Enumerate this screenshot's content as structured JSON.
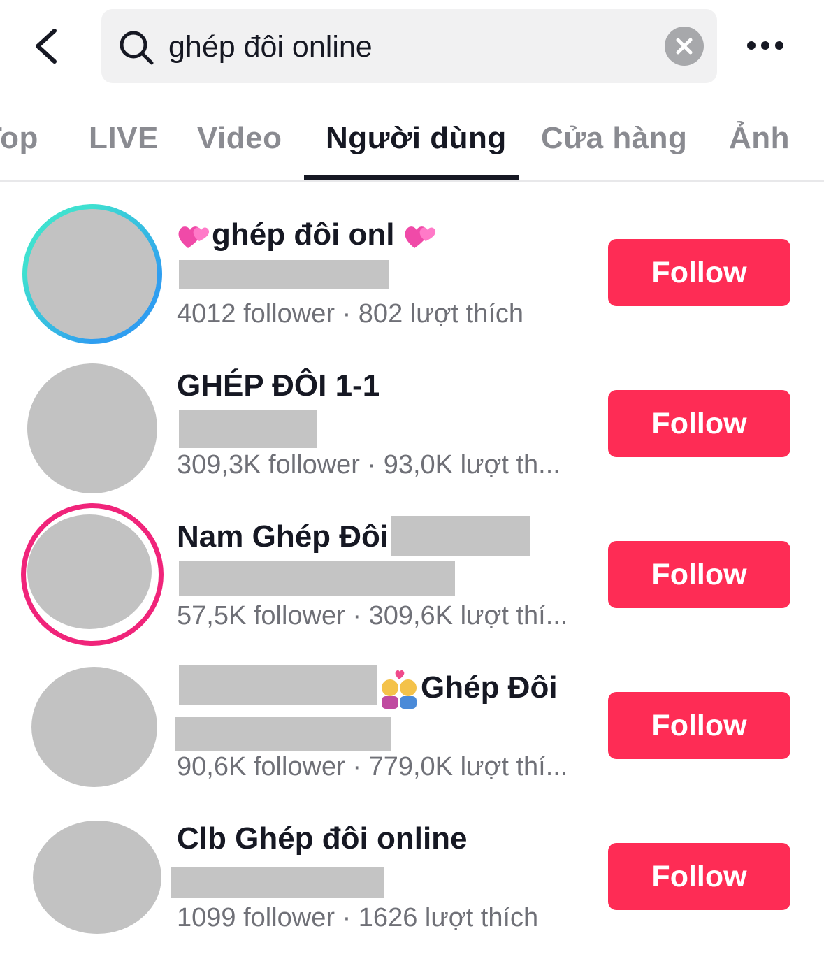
{
  "search": {
    "query": "ghép đôi online"
  },
  "tabs": [
    {
      "label": "Top"
    },
    {
      "label": "LIVE"
    },
    {
      "label": "Video"
    },
    {
      "label": "Người dùng",
      "active": true
    },
    {
      "label": "Cửa hàng"
    },
    {
      "label": "Ảnh"
    }
  ],
  "results": [
    {
      "name": "ghép đôi onl",
      "name_emoji": "heart-sparkle-emoji",
      "stats": "4012 follower · 802 lượt thích",
      "follow_label": "Follow"
    },
    {
      "name": "GHÉP ĐÔI 1-1",
      "stats": "309,3K follower · 93,0K lượt th...",
      "follow_label": "Follow"
    },
    {
      "name": "Nam Ghép Đôi",
      "stats": "57,5K follower · 309,6K lượt thí...",
      "follow_label": "Follow"
    },
    {
      "name": "Ghép Đôi",
      "name_emoji": "couple-emoji",
      "stats": "90,6K follower · 779,0K lượt thí...",
      "follow_label": "Follow"
    },
    {
      "name": "Clb Ghép đôi online",
      "stats": "1099 follower · 1626 lượt thích",
      "follow_label": "Follow"
    }
  ],
  "colors": {
    "accent": "#fe2c55",
    "story_ring_blue": "#2f9ef0",
    "story_ring_teal": "#3fe0d0",
    "live_ring_pink": "#f0247a"
  }
}
